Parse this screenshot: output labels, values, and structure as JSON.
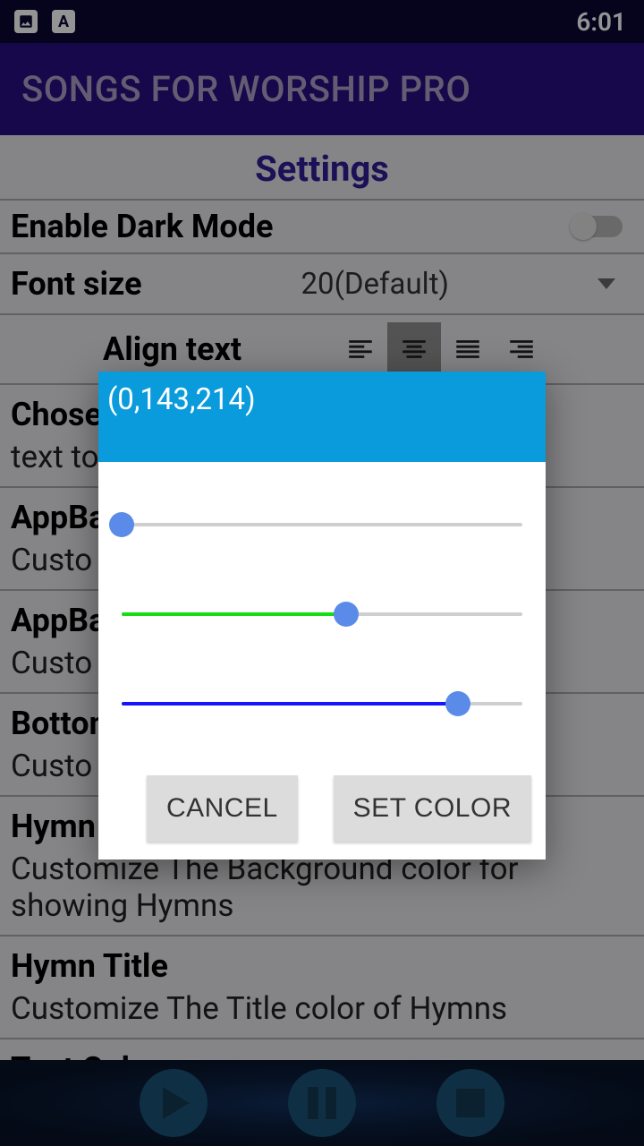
{
  "status": {
    "time": "6:01"
  },
  "app_bar": {
    "title": "SONGS FOR WORSHIP PRO"
  },
  "settings": {
    "title": "Settings",
    "dark_mode_label": "Enable Dark Mode",
    "font_size_label": "Font size",
    "font_size_value": "20(Default)",
    "align_label": "Align text",
    "sections": [
      {
        "title": "Chose",
        "sub": "text to"
      },
      {
        "title": "AppBa",
        "sub": "Custo"
      },
      {
        "title": "AppBa",
        "sub": "Custo"
      },
      {
        "title": "Bottom",
        "sub": "Custo"
      },
      {
        "title": "Hymn",
        "sub": "Customize The Background color for showing Hymns"
      },
      {
        "title": "Hymn Title",
        "sub": "Customize The Title color of Hymns"
      },
      {
        "title": "Text Colors",
        "sub": ""
      }
    ]
  },
  "dialog": {
    "rgb_label": "(0,143,214)",
    "r": 0,
    "g": 143,
    "b": 214,
    "max": 255,
    "cancel": "CANCEL",
    "set": "SET COLOR"
  }
}
